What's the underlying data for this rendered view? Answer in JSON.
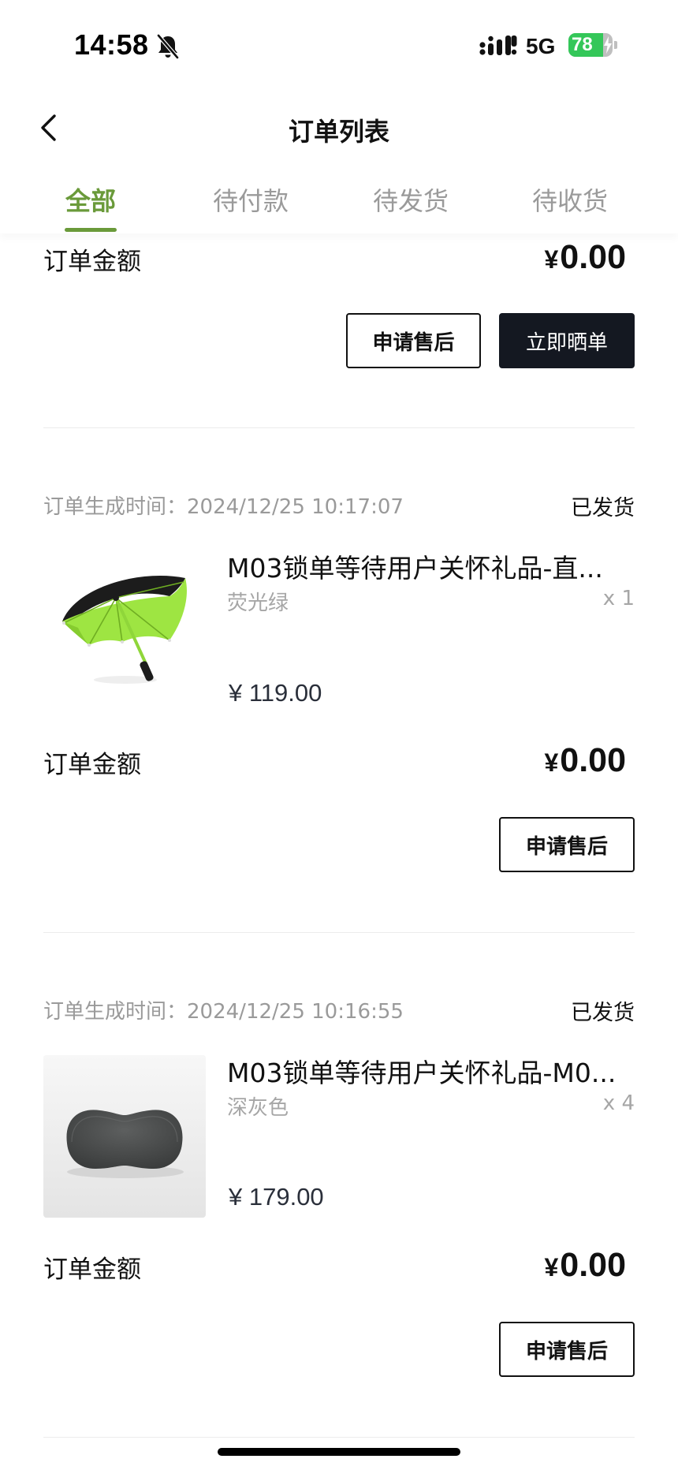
{
  "status_bar": {
    "time": "14:58",
    "network": "5G",
    "battery": 78,
    "battery_label": "78"
  },
  "header": {
    "title": "订单列表"
  },
  "tabs": [
    {
      "label": "全部",
      "active": true
    },
    {
      "label": "待付款",
      "active": false
    },
    {
      "label": "待发货",
      "active": false
    },
    {
      "label": "待收货",
      "active": false
    }
  ],
  "orders": [
    {
      "amount_label": "订单金额",
      "currency": "¥",
      "amount": "0.00",
      "buttons": [
        "申请售后",
        "立即晒单"
      ]
    },
    {
      "time_label": "订单生成时间：",
      "time": "2024/12/25 10:17:07",
      "status": "已发货",
      "product": {
        "name": "M03锁单等待用户关怀礼品-直...",
        "variant": "荧光绿",
        "quantity": "x 1",
        "price": "¥ 119.00"
      },
      "amount_label": "订单金额",
      "currency": "¥",
      "amount": "0.00",
      "buttons": [
        "申请售后"
      ]
    },
    {
      "time_label": "订单生成时间：",
      "time": "2024/12/25 10:16:55",
      "status": "已发货",
      "product": {
        "name": "M03锁单等待用户关怀礼品-M0...",
        "variant": "深灰色",
        "quantity": "x 4",
        "price": "¥ 179.00"
      },
      "amount_label": "订单金额",
      "currency": "¥",
      "amount": "0.00",
      "buttons": [
        "申请售后"
      ]
    }
  ],
  "colors": {
    "accent": "#6a9a3a",
    "dark_button": "#141821",
    "muted_text": "#9a9a9a",
    "battery": "#34c759"
  },
  "icons": [
    "bell-slash-icon",
    "signal-icon",
    "battery-icon",
    "back-chevron-icon"
  ]
}
